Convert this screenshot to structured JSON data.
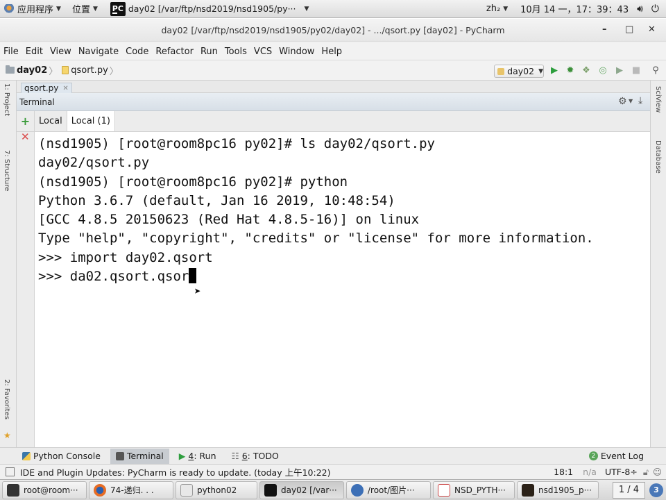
{
  "top_panel": {
    "apps_label": "应用程序",
    "places_label": "位置",
    "active_window": "day02 [/var/ftp/nsd2019/nsd1905/py···",
    "input_method": "zh₂",
    "datetime": "10月 14 一，17：39：43"
  },
  "window": {
    "title": "day02 [/var/ftp/nsd2019/nsd1905/py02/day02] - .../qsort.py [day02] - PyCharm"
  },
  "menu": [
    "File",
    "Edit",
    "View",
    "Navigate",
    "Code",
    "Refactor",
    "Run",
    "Tools",
    "VCS",
    "Window",
    "Help"
  ],
  "nav": {
    "project": "day02",
    "file": "qsort.py",
    "run_config": "day02"
  },
  "editor_tab": "qsort.py",
  "left_strip": {
    "project_label": "1: Project",
    "structure_label": "7: Structure",
    "favorites_label": "2: Favorites"
  },
  "right_strip": {
    "scview_label": "SciView",
    "database_label": "Database"
  },
  "terminal": {
    "header": "Terminal",
    "tabs": [
      "Local",
      "Local (1)"
    ],
    "lines": [
      "(nsd1905) [root@room8pc16 py02]# ls day02/qsort.py",
      "day02/qsort.py",
      "(nsd1905) [root@room8pc16 py02]# python",
      "Python 3.6.7 (default, Jan 16 2019, 10:48:54)",
      "[GCC 4.8.5 20150623 (Red Hat 4.8.5-16)] on linux",
      "Type \"help\", \"copyright\", \"credits\" or \"license\" for more information.",
      ">>> import day02.qsort"
    ],
    "current_input": ">>> da02.qsort.qsor"
  },
  "tool_tabs": {
    "python_console": "Python Console",
    "terminal": "Terminal",
    "run_num": "4",
    "run": ": Run",
    "todo_num": "6",
    "todo": ": TODO",
    "event_log": "Event Log",
    "event_log_count": "2"
  },
  "status": {
    "message": "IDE and Plugin Updates: PyCharm is ready to update. (today 上午10:22)",
    "position": "18:1",
    "na": "n/a",
    "encoding": "UTF-8÷"
  },
  "taskbar": {
    "items": [
      "root@room···",
      "74-递归. . .",
      "python02",
      "day02 [/var···",
      "/root/图片···",
      "NSD_PYTH···",
      "nsd1905_p···"
    ],
    "workspace": "1 / 4",
    "workspace_badge": "3"
  }
}
